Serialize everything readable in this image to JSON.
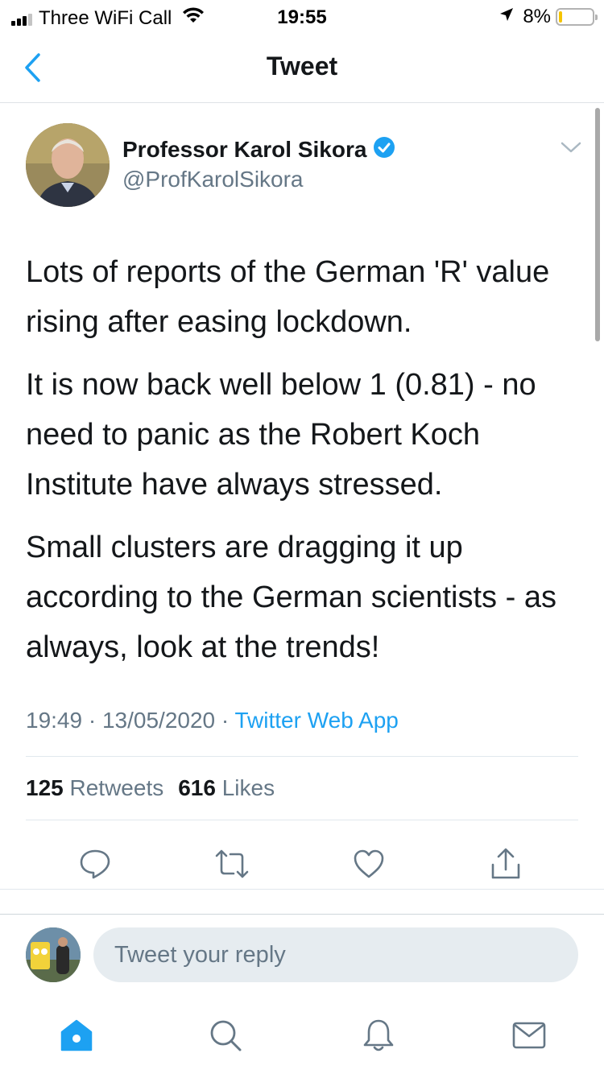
{
  "status_bar": {
    "carrier": "Three WiFi Call",
    "time": "19:55",
    "battery": "8%"
  },
  "nav": {
    "title": "Tweet"
  },
  "tweet": {
    "author_name": "Professor Karol Sikora",
    "handle": "@ProfKarolSikora",
    "paragraphs": [
      "Lots of reports of the German 'R' value rising after easing lockdown.",
      "It is now back well below 1 (0.81) - no need to panic as the Robert Koch Institute have always stressed.",
      "Small clusters are dragging it up according to the German scientists - as always, look at the trends!"
    ],
    "time": "19:49",
    "date": "13/05/2020",
    "separator": " · ",
    "source": "Twitter Web App",
    "retweets_count": "125",
    "retweets_label": "Retweets",
    "likes_count": "616",
    "likes_label": "Likes"
  },
  "reply": {
    "placeholder": "Tweet your reply"
  },
  "tabs": [
    {
      "icon": "home-icon",
      "active": true
    },
    {
      "icon": "search-icon",
      "active": false
    },
    {
      "icon": "bell-icon",
      "active": false
    },
    {
      "icon": "mail-icon",
      "active": false
    }
  ],
  "colors": {
    "accent": "#1da1f2",
    "text": "#14171a",
    "secondary": "#657786",
    "divider": "#e1e8ed"
  }
}
